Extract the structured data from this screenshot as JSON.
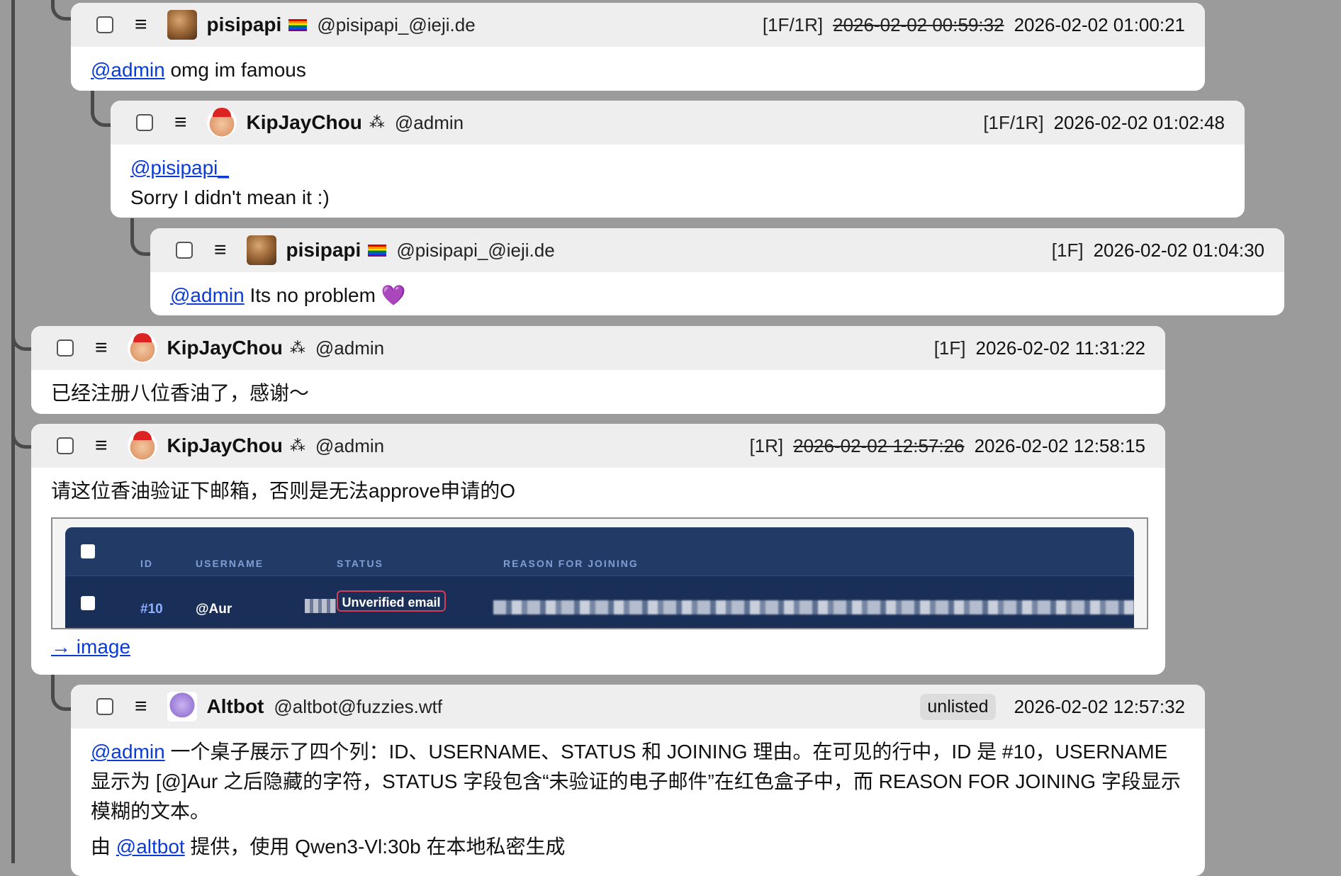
{
  "posts": [
    {
      "name": "pisipapi",
      "handle": "@pisipapi_@ieji.de",
      "stats": "[1F/1R]",
      "old_time": "2026-02-02 00:59:32",
      "time": "2026-02-02 01:00:21",
      "mention": "@admin",
      "text": " omg im famous"
    },
    {
      "name": "KipJayChou",
      "flair": "⁂",
      "handle": "@admin",
      "stats": "[1F/1R]",
      "time": "2026-02-02 01:02:48",
      "mention": "@pisipapi_",
      "text": "Sorry I didn't mean it :)"
    },
    {
      "name": "pisipapi",
      "handle": "@pisipapi_@ieji.de",
      "stats": "[1F]",
      "time": "2026-02-02 01:04:30",
      "mention": "@admin",
      "text": " Its no problem 💜"
    },
    {
      "name": "KipJayChou",
      "flair": "⁂",
      "handle": "@admin",
      "stats": "[1F]",
      "time": "2026-02-02 11:31:22",
      "text": "已经注册八位香油了，感谢～"
    },
    {
      "name": "KipJayChou",
      "flair": "⁂",
      "handle": "@admin",
      "stats": "[1R]",
      "old_time": "2026-02-02 12:57:26",
      "time": "2026-02-02 12:58:15",
      "text": "请这位香油验证下邮箱，否则是无法approve申请的O",
      "image_link": "→ image",
      "embed": {
        "headers": [
          "ID",
          "USERNAME",
          "STATUS",
          "REASON FOR JOINING"
        ],
        "row_id": "#10",
        "row_username": "@Aur",
        "row_status": "Unverified email"
      }
    },
    {
      "name": "Altbot",
      "handle": "@altbot@fuzzies.wtf",
      "visibility": "unlisted",
      "time": "2026-02-02 12:57:32",
      "mention": "@admin",
      "text": " 一个桌子展示了四个列：ID、USERNAME、STATUS 和 JOINING 理由。在可见的行中，ID 是 #10，USERNAME 显示为 [@]Aur 之后隐藏的字符，STATUS 字段包含“未验证的电子邮件”在红色盒子中，而 REASON FOR JOINING 字段显示模糊的文本。",
      "footer_prefix": "由 ",
      "footer_mention": "@altbot",
      "footer_suffix": " 提供，使用 Qwen3-Vl:30b 在本地私密生成"
    }
  ],
  "icons": {
    "menu": "≡",
    "checkbox": "checkbox-icon",
    "pride_flag": "rainbow-flag-icon"
  }
}
